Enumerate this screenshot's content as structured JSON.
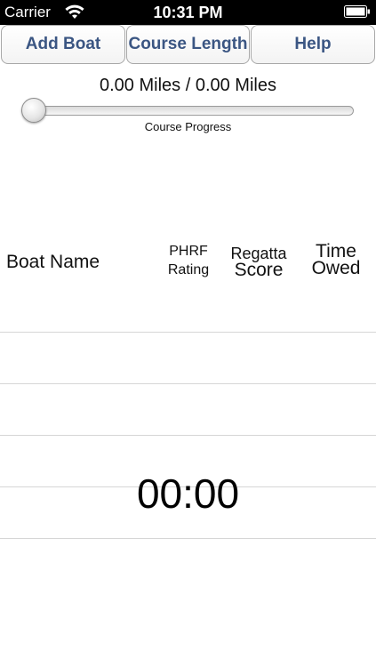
{
  "status_bar": {
    "carrier": "Carrier",
    "time": "10:31 PM",
    "icons": [
      "wifi-icon",
      "battery-icon"
    ]
  },
  "toolbar": {
    "add_boat_label": "Add Boat",
    "course_length_label": "Course Length",
    "help_label": "Help",
    "accent_color": "#3b5683"
  },
  "progress": {
    "label": "0.00 Miles / 0.00 Miles",
    "caption": "Course Progress",
    "value": 0.0
  },
  "table": {
    "headers": {
      "boat_name": "Boat Name",
      "phrf_line1": "PHRF",
      "phrf_line2": "Rating",
      "regatta_line1": "Regatta",
      "regatta_line2": "Score",
      "time_line1": "Time",
      "time_line2": "Owed"
    },
    "rows": []
  },
  "timer": {
    "value": "00:00"
  }
}
